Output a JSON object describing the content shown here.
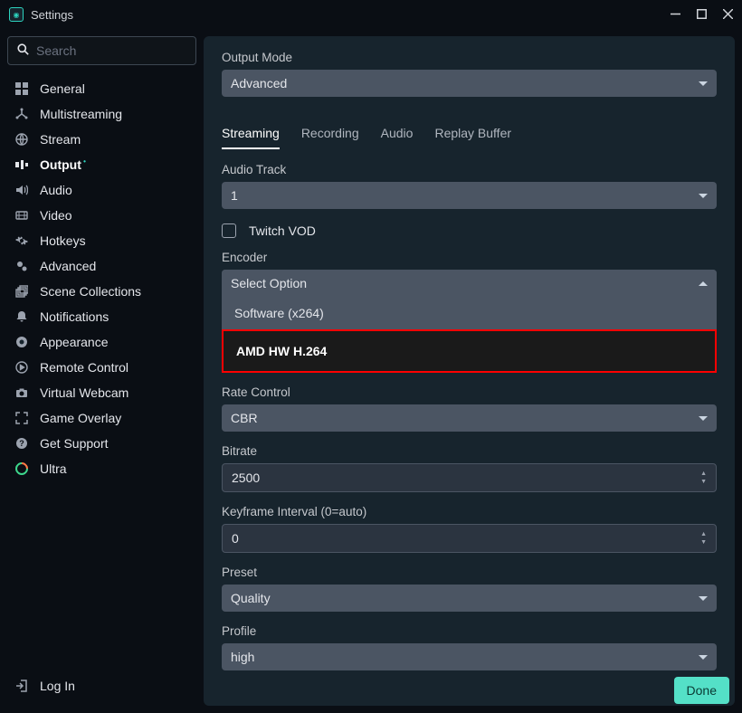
{
  "window": {
    "title": "Settings"
  },
  "search": {
    "placeholder": "Search"
  },
  "sidebar": {
    "items": [
      {
        "label": "General"
      },
      {
        "label": "Multistreaming"
      },
      {
        "label": "Stream"
      },
      {
        "label": "Output"
      },
      {
        "label": "Audio"
      },
      {
        "label": "Video"
      },
      {
        "label": "Hotkeys"
      },
      {
        "label": "Advanced"
      },
      {
        "label": "Scene Collections"
      },
      {
        "label": "Notifications"
      },
      {
        "label": "Appearance"
      },
      {
        "label": "Remote Control"
      },
      {
        "label": "Virtual Webcam"
      },
      {
        "label": "Game Overlay"
      },
      {
        "label": "Get Support"
      },
      {
        "label": "Ultra"
      }
    ],
    "login_label": "Log In"
  },
  "output": {
    "mode_label": "Output Mode",
    "mode_value": "Advanced",
    "tabs": {
      "streaming": "Streaming",
      "recording": "Recording",
      "audio": "Audio",
      "replay": "Replay Buffer"
    },
    "audio_track_label": "Audio Track",
    "audio_track_value": "1",
    "twitch_vod_label": "Twitch VOD",
    "encoder_label": "Encoder",
    "encoder_placeholder": "Select Option",
    "encoder_options": {
      "software": "Software (x264)",
      "amd": "AMD HW H.264"
    },
    "rate_control_label": "Rate Control",
    "rate_control_value": "CBR",
    "bitrate_label": "Bitrate",
    "bitrate_value": "2500",
    "keyframe_label": "Keyframe Interval (0=auto)",
    "keyframe_value": "0",
    "preset_label": "Preset",
    "preset_value": "Quality",
    "profile_label": "Profile",
    "profile_value": "high"
  },
  "footer": {
    "done": "Done"
  }
}
